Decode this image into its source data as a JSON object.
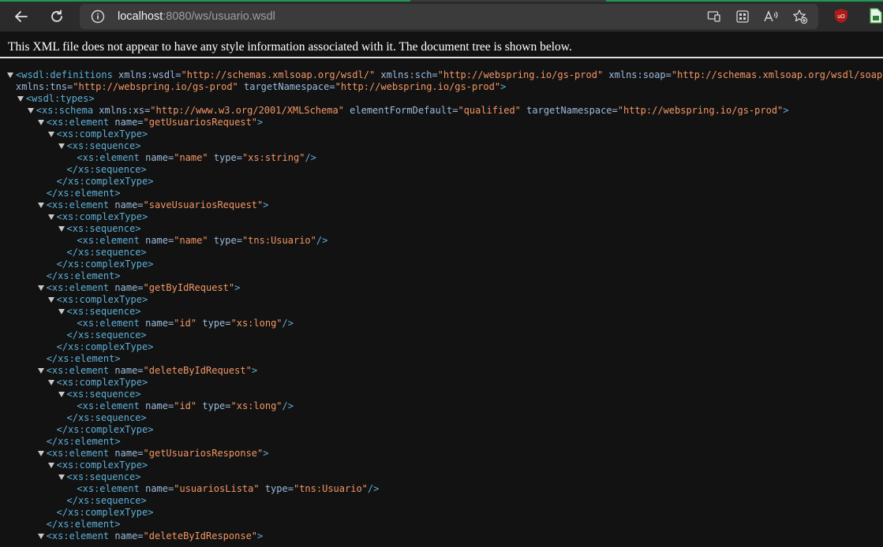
{
  "browser": {
    "url_host": "localhost",
    "url_rest": ":8080/ws/usuario.wsdl",
    "buttons": {
      "back_icon": "arrow-left-icon",
      "reload_icon": "reload-icon",
      "info_icon": "info-icon"
    }
  },
  "banner": {
    "text": "This XML file does not appear to have any style information associated with it. The document tree is shown below."
  },
  "colors": {
    "tag": "#5db0d7",
    "attr_name": "#9bbbdc",
    "attr_value": "#f29766",
    "background": "#121212",
    "toolbar": "#2b2b2b"
  },
  "xml_lines": [
    {
      "d": 0,
      "t": true,
      "p": [
        [
          "tag",
          "<wsdl:definitions"
        ],
        [
          "an",
          " xmlns:wsdl="
        ],
        [
          "av",
          "\"http://schemas.xmlsoap.org/wsdl/\""
        ],
        [
          "an",
          " xmlns:sch="
        ],
        [
          "av",
          "\"http://webspring.io/gs-prod\""
        ],
        [
          "an",
          " xmlns:soap="
        ],
        [
          "av",
          "\"http://schemas.xmlsoap.org/wsdl/soap/\""
        ]
      ]
    },
    {
      "d": 0,
      "t": false,
      "p": [
        [
          "an",
          "xmlns:tns="
        ],
        [
          "av",
          "\"http://webspring.io/gs-prod\""
        ],
        [
          "an",
          " targetNamespace="
        ],
        [
          "av",
          "\"http://webspring.io/gs-prod\""
        ],
        [
          "tag",
          ">"
        ]
      ]
    },
    {
      "d": 1,
      "t": true,
      "p": [
        [
          "tag",
          "<wsdl:types>"
        ]
      ]
    },
    {
      "d": 2,
      "t": true,
      "p": [
        [
          "tag",
          "<xs:schema"
        ],
        [
          "an",
          " xmlns:xs="
        ],
        [
          "av",
          "\"http://www.w3.org/2001/XMLSchema\""
        ],
        [
          "an",
          " elementFormDefault="
        ],
        [
          "av",
          "\"qualified\""
        ],
        [
          "an",
          " targetNamespace="
        ],
        [
          "av",
          "\"http://webspring.io/gs-prod\""
        ],
        [
          "tag",
          ">"
        ]
      ]
    },
    {
      "d": 3,
      "t": true,
      "p": [
        [
          "tag",
          "<xs:element"
        ],
        [
          "an",
          " name="
        ],
        [
          "av",
          "\"getUsuariosRequest\""
        ],
        [
          "tag",
          ">"
        ]
      ]
    },
    {
      "d": 4,
      "t": true,
      "p": [
        [
          "tag",
          "<xs:complexType>"
        ]
      ]
    },
    {
      "d": 5,
      "t": true,
      "p": [
        [
          "tag",
          "<xs:sequence>"
        ]
      ]
    },
    {
      "d": 6,
      "t": false,
      "p": [
        [
          "tag",
          "<xs:element"
        ],
        [
          "an",
          " name="
        ],
        [
          "av",
          "\"name\""
        ],
        [
          "an",
          " type="
        ],
        [
          "av",
          "\"xs:string\""
        ],
        [
          "tag",
          "/>"
        ]
      ]
    },
    {
      "d": 5,
      "t": false,
      "p": [
        [
          "tag",
          "</xs:sequence>"
        ]
      ]
    },
    {
      "d": 4,
      "t": false,
      "p": [
        [
          "tag",
          "</xs:complexType>"
        ]
      ]
    },
    {
      "d": 3,
      "t": false,
      "p": [
        [
          "tag",
          "</xs:element>"
        ]
      ]
    },
    {
      "d": 3,
      "t": true,
      "p": [
        [
          "tag",
          "<xs:element"
        ],
        [
          "an",
          " name="
        ],
        [
          "av",
          "\"saveUsuariosRequest\""
        ],
        [
          "tag",
          ">"
        ]
      ]
    },
    {
      "d": 4,
      "t": true,
      "p": [
        [
          "tag",
          "<xs:complexType>"
        ]
      ]
    },
    {
      "d": 5,
      "t": true,
      "p": [
        [
          "tag",
          "<xs:sequence>"
        ]
      ]
    },
    {
      "d": 6,
      "t": false,
      "p": [
        [
          "tag",
          "<xs:element"
        ],
        [
          "an",
          " name="
        ],
        [
          "av",
          "\"name\""
        ],
        [
          "an",
          " type="
        ],
        [
          "av",
          "\"tns:Usuario\""
        ],
        [
          "tag",
          "/>"
        ]
      ]
    },
    {
      "d": 5,
      "t": false,
      "p": [
        [
          "tag",
          "</xs:sequence>"
        ]
      ]
    },
    {
      "d": 4,
      "t": false,
      "p": [
        [
          "tag",
          "</xs:complexType>"
        ]
      ]
    },
    {
      "d": 3,
      "t": false,
      "p": [
        [
          "tag",
          "</xs:element>"
        ]
      ]
    },
    {
      "d": 3,
      "t": true,
      "p": [
        [
          "tag",
          "<xs:element"
        ],
        [
          "an",
          " name="
        ],
        [
          "av",
          "\"getByIdRequest\""
        ],
        [
          "tag",
          ">"
        ]
      ]
    },
    {
      "d": 4,
      "t": true,
      "p": [
        [
          "tag",
          "<xs:complexType>"
        ]
      ]
    },
    {
      "d": 5,
      "t": true,
      "p": [
        [
          "tag",
          "<xs:sequence>"
        ]
      ]
    },
    {
      "d": 6,
      "t": false,
      "p": [
        [
          "tag",
          "<xs:element"
        ],
        [
          "an",
          " name="
        ],
        [
          "av",
          "\"id\""
        ],
        [
          "an",
          " type="
        ],
        [
          "av",
          "\"xs:long\""
        ],
        [
          "tag",
          "/>"
        ]
      ]
    },
    {
      "d": 5,
      "t": false,
      "p": [
        [
          "tag",
          "</xs:sequence>"
        ]
      ]
    },
    {
      "d": 4,
      "t": false,
      "p": [
        [
          "tag",
          "</xs:complexType>"
        ]
      ]
    },
    {
      "d": 3,
      "t": false,
      "p": [
        [
          "tag",
          "</xs:element>"
        ]
      ]
    },
    {
      "d": 3,
      "t": true,
      "p": [
        [
          "tag",
          "<xs:element"
        ],
        [
          "an",
          " name="
        ],
        [
          "av",
          "\"deleteByIdRequest\""
        ],
        [
          "tag",
          ">"
        ]
      ]
    },
    {
      "d": 4,
      "t": true,
      "p": [
        [
          "tag",
          "<xs:complexType>"
        ]
      ]
    },
    {
      "d": 5,
      "t": true,
      "p": [
        [
          "tag",
          "<xs:sequence>"
        ]
      ]
    },
    {
      "d": 6,
      "t": false,
      "p": [
        [
          "tag",
          "<xs:element"
        ],
        [
          "an",
          " name="
        ],
        [
          "av",
          "\"id\""
        ],
        [
          "an",
          " type="
        ],
        [
          "av",
          "\"xs:long\""
        ],
        [
          "tag",
          "/>"
        ]
      ]
    },
    {
      "d": 5,
      "t": false,
      "p": [
        [
          "tag",
          "</xs:sequence>"
        ]
      ]
    },
    {
      "d": 4,
      "t": false,
      "p": [
        [
          "tag",
          "</xs:complexType>"
        ]
      ]
    },
    {
      "d": 3,
      "t": false,
      "p": [
        [
          "tag",
          "</xs:element>"
        ]
      ]
    },
    {
      "d": 3,
      "t": true,
      "p": [
        [
          "tag",
          "<xs:element"
        ],
        [
          "an",
          " name="
        ],
        [
          "av",
          "\"getUsuariosResponse\""
        ],
        [
          "tag",
          ">"
        ]
      ]
    },
    {
      "d": 4,
      "t": true,
      "p": [
        [
          "tag",
          "<xs:complexType>"
        ]
      ]
    },
    {
      "d": 5,
      "t": true,
      "p": [
        [
          "tag",
          "<xs:sequence>"
        ]
      ]
    },
    {
      "d": 6,
      "t": false,
      "p": [
        [
          "tag",
          "<xs:element"
        ],
        [
          "an",
          " name="
        ],
        [
          "av",
          "\"usuariosLista\""
        ],
        [
          "an",
          " type="
        ],
        [
          "av",
          "\"tns:Usuario\""
        ],
        [
          "tag",
          "/>"
        ]
      ]
    },
    {
      "d": 5,
      "t": false,
      "p": [
        [
          "tag",
          "</xs:sequence>"
        ]
      ]
    },
    {
      "d": 4,
      "t": false,
      "p": [
        [
          "tag",
          "</xs:complexType>"
        ]
      ]
    },
    {
      "d": 3,
      "t": false,
      "p": [
        [
          "tag",
          "</xs:element>"
        ]
      ]
    },
    {
      "d": 3,
      "t": true,
      "p": [
        [
          "tag",
          "<xs:element"
        ],
        [
          "an",
          " name="
        ],
        [
          "av",
          "\"deleteByIdResponse\""
        ],
        [
          "tag",
          ">"
        ]
      ]
    }
  ]
}
